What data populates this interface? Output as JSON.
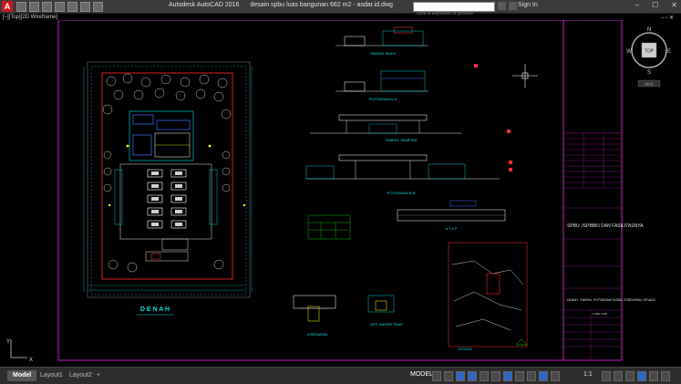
{
  "app": {
    "logo": "A",
    "name": "Autodesk AutoCAD 2016",
    "file": "desain spbu luas bangunan 662 m2 - asdar.id.dwg"
  },
  "search": {
    "placeholder": "Type a keyword or phrase"
  },
  "account": {
    "signin": "Sign In"
  },
  "window_controls": [
    "–",
    "☐",
    "✕"
  ],
  "viewport": {
    "label": "[–][Top][2D Wireframe]",
    "controls": "– ▫ ✕"
  },
  "viewcube": {
    "n": "N",
    "s": "S",
    "e": "E",
    "w": "W",
    "top": "TOP",
    "wcs": "WCS"
  },
  "drawing": {
    "plan_title": "D E N A H",
    "views": {
      "tampak_muka": "TAMPAK MUKA",
      "tampak_samping": "TAMPAK SAMPING",
      "potongan_aa": "POTONGAN A-A",
      "potongan_bb": "POTONGAN B-B",
      "tampak_samping2": "TAMPAK SAMPING",
      "atap": "A T A P",
      "resapan": "S.RESAPAN",
      "water_trap": "DET. WATER TRAP",
      "situasi": "SITUASI"
    }
  },
  "title_block": {
    "project": "SPBU ,ISPBBKI DAN FASILITASNYA",
    "drawing_desc": "DENAH, TAMPAK, POTONGAN FASAD, S.RESAPAN, SITUASI",
    "scale": "1:100 / 1:50"
  },
  "status": {
    "tabs": [
      "Model",
      "Layout1",
      "Layout2"
    ],
    "add_tab": "+",
    "space": "MODEL",
    "scale": "1:1"
  },
  "colors": {
    "frame": "#c61ec6",
    "accent": "#3a72ff"
  }
}
